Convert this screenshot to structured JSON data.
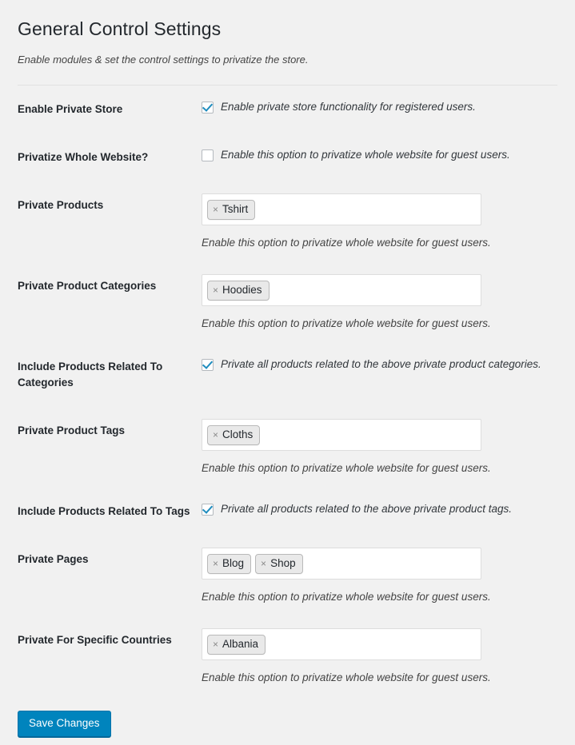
{
  "page": {
    "title": "General Control Settings",
    "subtitle": "Enable modules & set the control settings to privatize the store."
  },
  "colors": {
    "background": "#f1f1f1",
    "accent": "#0084bd",
    "checkmark": "#1e8cbe",
    "label": "#23282d",
    "help": "#444444"
  },
  "rows": [
    {
      "label": "Enable Private Store",
      "type": "checkbox",
      "checked": true,
      "checkbox_text": "Enable private store functionality for registered users."
    },
    {
      "label": "Privatize Whole Website?",
      "type": "checkbox",
      "checked": false,
      "checkbox_text": "Enable this option to privatize whole website for guest users."
    },
    {
      "label": "Private Products",
      "type": "tags",
      "tags": [
        "Tshirt"
      ],
      "help": "Enable this option to privatize whole website for guest users."
    },
    {
      "label": "Private Product Categories",
      "type": "tags",
      "tags": [
        "Hoodies"
      ],
      "help": "Enable this option to privatize whole website for guest users."
    },
    {
      "label": "Include Products Related To Categories",
      "type": "checkbox",
      "checked": true,
      "checkbox_text": "Private all products related to the above private product categories."
    },
    {
      "label": "Private Product Tags",
      "type": "tags",
      "tags": [
        "Cloths"
      ],
      "help": "Enable this option to privatize whole website for guest users."
    },
    {
      "label": "Include Products Related To Tags",
      "type": "checkbox",
      "checked": true,
      "checkbox_text": "Private all products related to the above private product tags."
    },
    {
      "label": "Private Pages",
      "type": "tags",
      "tags": [
        "Blog",
        "Shop"
      ],
      "help": "Enable this option to privatize whole website for guest users."
    },
    {
      "label": "Private For Specific Countries",
      "type": "tags",
      "tags": [
        "Albania"
      ],
      "help": "Enable this option to privatize whole website for guest users."
    }
  ],
  "chip_remove_glyph": "×",
  "submit": {
    "save_label": "Save Changes"
  }
}
